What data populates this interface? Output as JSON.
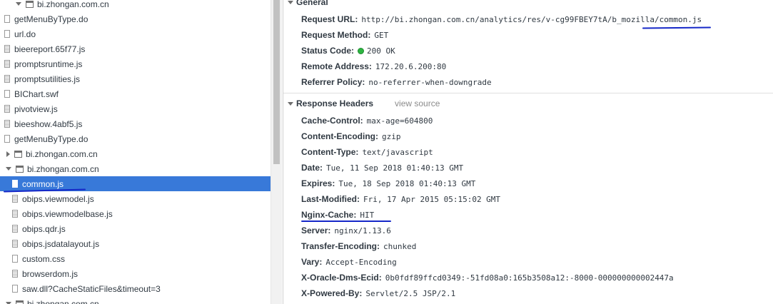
{
  "files": [
    {
      "name": "bi.zhongan.com.cn",
      "type": "frame-top",
      "indent": 1
    },
    {
      "name": "getMenuByType.do",
      "type": "file",
      "indent": 0
    },
    {
      "name": "url.do",
      "type": "file",
      "indent": 0
    },
    {
      "name": "bieereport.65f77.js",
      "type": "file-stripe",
      "indent": 0
    },
    {
      "name": "promptsruntime.js",
      "type": "file-stripe",
      "indent": 0
    },
    {
      "name": "promptsutilities.js",
      "type": "file-stripe",
      "indent": 0
    },
    {
      "name": "BIChart.swf",
      "type": "file",
      "indent": 0
    },
    {
      "name": "pivotview.js",
      "type": "file-stripe",
      "indent": 0
    },
    {
      "name": "bieeshow.4abf5.js",
      "type": "file-stripe",
      "indent": 0
    },
    {
      "name": "getMenuByType.do",
      "type": "file",
      "indent": 0
    },
    {
      "name": "bi.zhongan.com.cn",
      "type": "frame-collapsed",
      "indent": 0
    },
    {
      "name": "bi.zhongan.com.cn",
      "type": "frame-expanded",
      "indent": 0
    },
    {
      "name": "common.js",
      "type": "file-selected",
      "indent": 1
    },
    {
      "name": "obips.viewmodel.js",
      "type": "file-stripe",
      "indent": 1
    },
    {
      "name": "obips.viewmodelbase.js",
      "type": "file-stripe",
      "indent": 1
    },
    {
      "name": "obips.qdr.js",
      "type": "file-stripe",
      "indent": 1
    },
    {
      "name": "obips.jsdatalayout.js",
      "type": "file-stripe",
      "indent": 1
    },
    {
      "name": "custom.css",
      "type": "file",
      "indent": 1
    },
    {
      "name": "browserdom.js",
      "type": "file-stripe",
      "indent": 1
    },
    {
      "name": "saw.dll?CacheStaticFiles&timeout=3",
      "type": "file",
      "indent": 1
    },
    {
      "name": "bi.zhongan.com.cn",
      "type": "frame-expanded",
      "indent": 0
    }
  ],
  "general": {
    "title": "General",
    "rows": [
      {
        "name": "Request URL:",
        "value": "http://bi.zhongan.com.cn/analytics/res/v-cg99FBEY7tA/b_mozilla/common.js"
      },
      {
        "name": "Request Method:",
        "value": "GET"
      },
      {
        "name": "Status Code:",
        "value": "200 OK",
        "status_color": "#2db541"
      },
      {
        "name": "Remote Address:",
        "value": "172.20.6.200:80"
      },
      {
        "name": "Referrer Policy:",
        "value": "no-referrer-when-downgrade"
      }
    ]
  },
  "response": {
    "title": "Response Headers",
    "view_source": "view source",
    "rows": [
      {
        "name": "Cache-Control:",
        "value": "max-age=604800"
      },
      {
        "name": "Content-Encoding:",
        "value": "gzip"
      },
      {
        "name": "Content-Type:",
        "value": "text/javascript"
      },
      {
        "name": "Date:",
        "value": "Tue, 11 Sep 2018 01:40:13 GMT"
      },
      {
        "name": "Expires:",
        "value": "Tue, 18 Sep 2018 01:40:13 GMT"
      },
      {
        "name": "Last-Modified:",
        "value": "Fri, 17 Apr 2015 05:15:02 GMT"
      },
      {
        "name": "Nginx-Cache:",
        "value": "HIT"
      },
      {
        "name": "Server:",
        "value": "nginx/1.13.6"
      },
      {
        "name": "Transfer-Encoding:",
        "value": "chunked"
      },
      {
        "name": "Vary:",
        "value": "Accept-Encoding"
      },
      {
        "name": "X-Oracle-Dms-Ecid:",
        "value": "0b0fdf89ffcd0349:-51fd08a0:165b3508a12:-8000-000000000002447a"
      },
      {
        "name": "X-Powered-By:",
        "value": "Servlet/2.5 JSP/2.1"
      }
    ]
  },
  "colors": {
    "selection": "#3879d9",
    "annotation": "#1628c8"
  }
}
